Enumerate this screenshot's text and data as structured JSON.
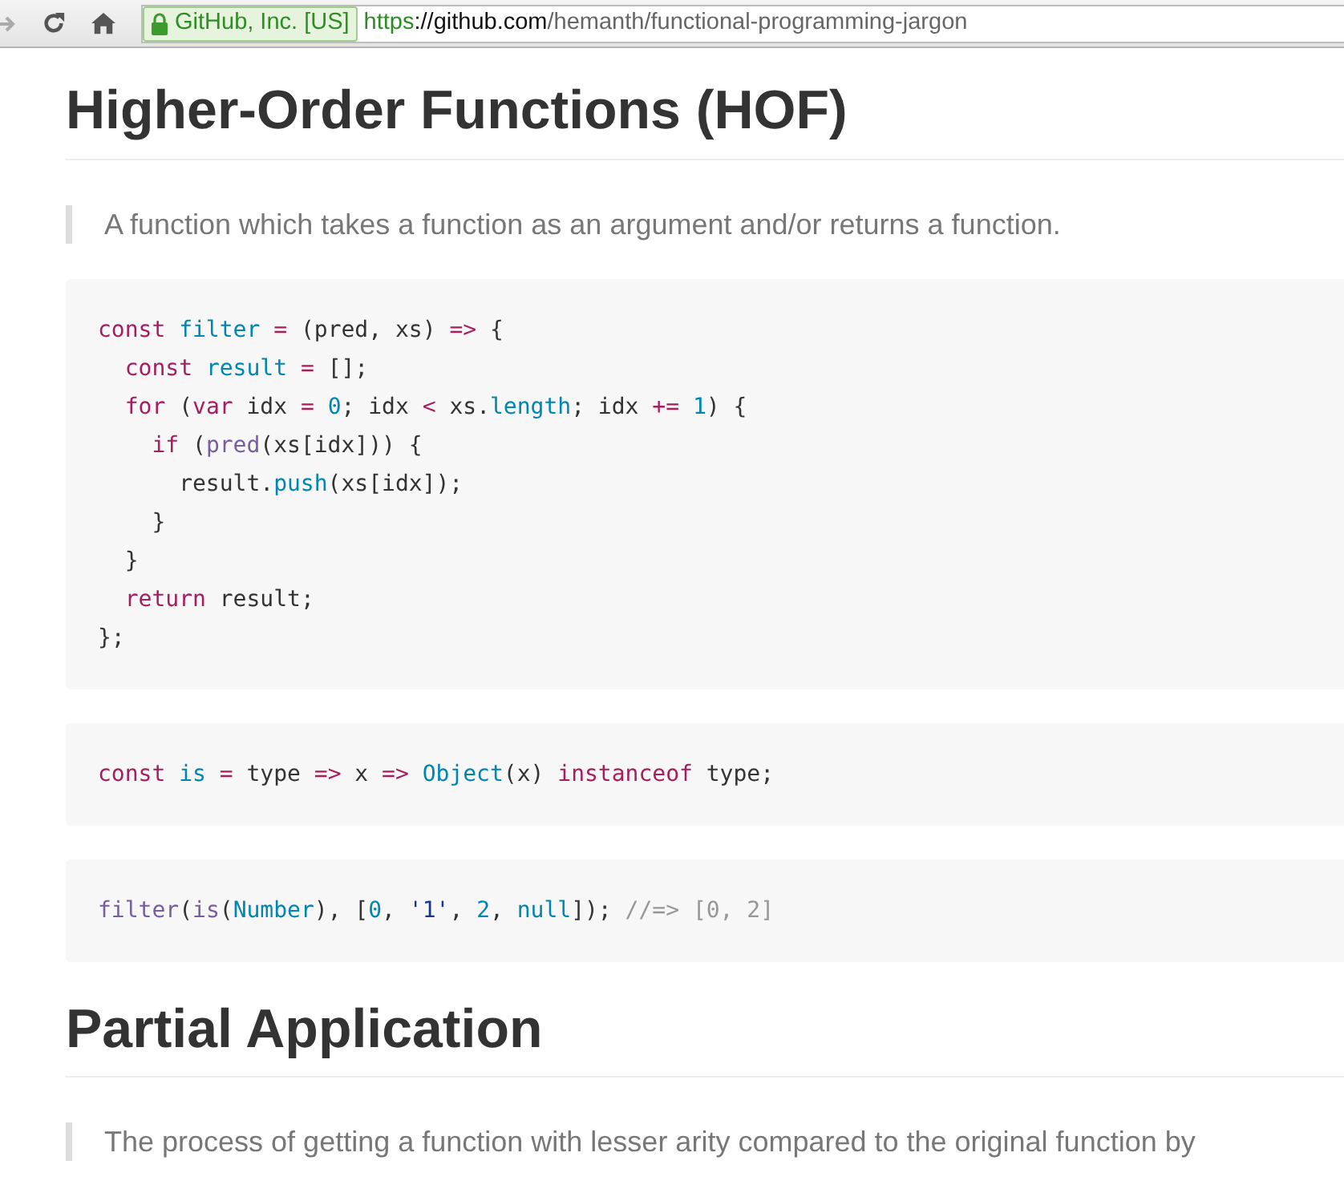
{
  "browser": {
    "site_badge": "GitHub, Inc. [US]",
    "url": {
      "scheme": "https",
      "host": "://github.com",
      "path": "/hemanth/functional-programming-jargon"
    }
  },
  "sections": [
    {
      "heading": "Higher-Order Functions (HOF)",
      "quote": "A function which takes a function as an argument and/or returns a function.",
      "code_blocks": [
        {
          "lines": [
            [
              {
                "kind": "keyword",
                "text": "const "
              },
              {
                "kind": "constant",
                "text": "filter "
              },
              {
                "kind": "keyword",
                "text": "="
              },
              {
                "kind": "plain",
                "text": " (pred, xs) "
              },
              {
                "kind": "keyword",
                "text": "=>"
              },
              {
                "kind": "plain",
                "text": " {"
              }
            ],
            [
              {
                "kind": "keyword",
                "text": "  const "
              },
              {
                "kind": "constant",
                "text": "result "
              },
              {
                "kind": "keyword",
                "text": "="
              },
              {
                "kind": "plain",
                "text": " [];"
              }
            ],
            [
              {
                "kind": "keyword",
                "text": "  for"
              },
              {
                "kind": "plain",
                "text": " ("
              },
              {
                "kind": "keyword",
                "text": "var"
              },
              {
                "kind": "plain",
                "text": " idx "
              },
              {
                "kind": "keyword",
                "text": "= "
              },
              {
                "kind": "constant",
                "text": "0"
              },
              {
                "kind": "plain",
                "text": "; idx "
              },
              {
                "kind": "keyword",
                "text": "<"
              },
              {
                "kind": "plain",
                "text": " xs."
              },
              {
                "kind": "constant",
                "text": "length"
              },
              {
                "kind": "plain",
                "text": "; idx "
              },
              {
                "kind": "keyword",
                "text": "+= "
              },
              {
                "kind": "constant",
                "text": "1"
              },
              {
                "kind": "plain",
                "text": ") {"
              }
            ],
            [
              {
                "kind": "keyword",
                "text": "    if"
              },
              {
                "kind": "plain",
                "text": " ("
              },
              {
                "kind": "entity",
                "text": "pred"
              },
              {
                "kind": "plain",
                "text": "(xs[idx])) {"
              }
            ],
            [
              {
                "kind": "plain",
                "text": "      result."
              },
              {
                "kind": "constant",
                "text": "push"
              },
              {
                "kind": "plain",
                "text": "(xs[idx]);"
              }
            ],
            [
              {
                "kind": "plain",
                "text": "    }"
              }
            ],
            [
              {
                "kind": "plain",
                "text": "  }"
              }
            ],
            [
              {
                "kind": "keyword",
                "text": "  return"
              },
              {
                "kind": "plain",
                "text": " result;"
              }
            ],
            [
              {
                "kind": "plain",
                "text": "};"
              }
            ]
          ]
        },
        {
          "lines": [
            [
              {
                "kind": "keyword",
                "text": "const "
              },
              {
                "kind": "constant",
                "text": "is "
              },
              {
                "kind": "keyword",
                "text": "="
              },
              {
                "kind": "plain",
                "text": " type "
              },
              {
                "kind": "keyword",
                "text": "=>"
              },
              {
                "kind": "plain",
                "text": " x "
              },
              {
                "kind": "keyword",
                "text": "=> "
              },
              {
                "kind": "constant",
                "text": "Object"
              },
              {
                "kind": "plain",
                "text": "(x) "
              },
              {
                "kind": "keyword",
                "text": "instanceof"
              },
              {
                "kind": "plain",
                "text": " type;"
              }
            ]
          ]
        },
        {
          "lines": [
            [
              {
                "kind": "entity",
                "text": "filter"
              },
              {
                "kind": "plain",
                "text": "("
              },
              {
                "kind": "entity",
                "text": "is"
              },
              {
                "kind": "plain",
                "text": "("
              },
              {
                "kind": "constant",
                "text": "Number"
              },
              {
                "kind": "plain",
                "text": "), ["
              },
              {
                "kind": "constant",
                "text": "0"
              },
              {
                "kind": "plain",
                "text": ", "
              },
              {
                "kind": "string",
                "text": "'1'"
              },
              {
                "kind": "plain",
                "text": ", "
              },
              {
                "kind": "constant",
                "text": "2"
              },
              {
                "kind": "plain",
                "text": ", "
              },
              {
                "kind": "constant",
                "text": "null"
              },
              {
                "kind": "plain",
                "text": "]); "
              },
              {
                "kind": "comment",
                "text": "//=> [0, 2]"
              }
            ]
          ]
        }
      ]
    },
    {
      "heading": "Partial Application",
      "quote": "The process of getting a function with lesser arity compared to the original function by"
    }
  ]
}
